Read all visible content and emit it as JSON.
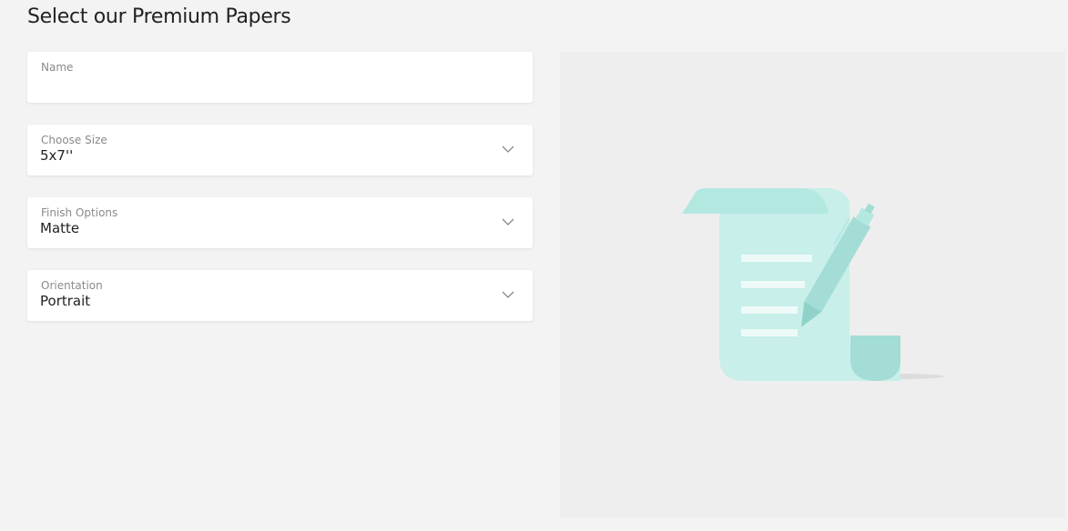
{
  "page": {
    "title": "Select our Premium Papers"
  },
  "form": {
    "name": {
      "label": "Name",
      "value": ""
    },
    "size": {
      "label": "Choose Size",
      "value": "5x7''"
    },
    "finish": {
      "label": "Finish Options",
      "value": "Matte"
    },
    "orientation": {
      "label": "Orientation",
      "value": "Portrait"
    }
  },
  "preview": {
    "illustration": "scroll-with-pen-icon"
  },
  "colors": {
    "background": "#f3f3f3",
    "card": "#ffffff",
    "preview_bg": "#eeeeee",
    "accent_light": "#c8efea",
    "accent_mid": "#b3e8e1",
    "accent_dark": "#a3ddd5"
  }
}
